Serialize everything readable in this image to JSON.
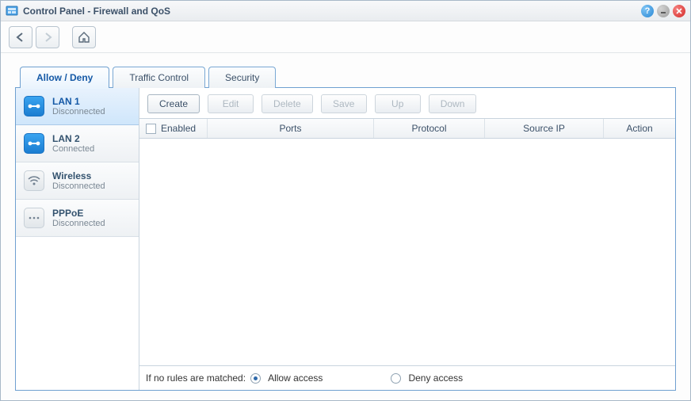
{
  "window": {
    "title": "Control Panel - Firewall and QoS"
  },
  "tabs": [
    {
      "label": "Allow / Deny",
      "active": true
    },
    {
      "label": "Traffic Control",
      "active": false
    },
    {
      "label": "Security",
      "active": false
    }
  ],
  "sidebar": {
    "items": [
      {
        "name": "LAN 1",
        "status": "Disconnected",
        "selected": true,
        "connected": false,
        "icon": "lan-icon"
      },
      {
        "name": "LAN 2",
        "status": "Connected",
        "selected": false,
        "connected": true,
        "icon": "lan-icon"
      },
      {
        "name": "Wireless",
        "status": "Disconnected",
        "selected": false,
        "connected": false,
        "icon": "wifi-icon"
      },
      {
        "name": "PPPoE",
        "status": "Disconnected",
        "selected": false,
        "connected": false,
        "icon": "pppoe-icon"
      }
    ]
  },
  "toolbar": {
    "create": "Create",
    "edit": "Edit",
    "delete": "Delete",
    "save": "Save",
    "up": "Up",
    "down": "Down"
  },
  "grid": {
    "columns": {
      "enabled": "Enabled",
      "ports": "Ports",
      "protocol": "Protocol",
      "source": "Source IP",
      "action": "Action"
    },
    "rows": []
  },
  "footer": {
    "prompt": "If no rules are matched:",
    "allow": "Allow access",
    "deny": "Deny access",
    "selected": "allow"
  }
}
